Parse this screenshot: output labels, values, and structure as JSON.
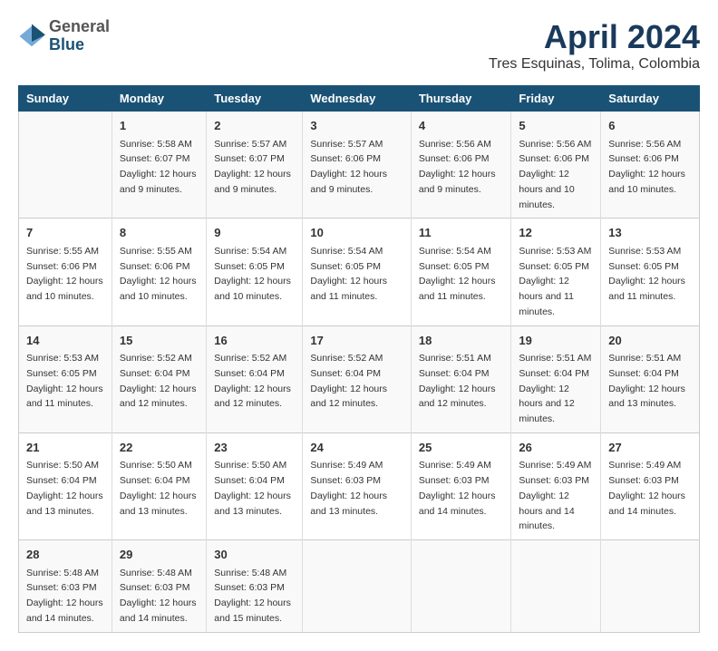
{
  "logo": {
    "general": "General",
    "blue": "Blue"
  },
  "title": "April 2024",
  "subtitle": "Tres Esquinas, Tolima, Colombia",
  "columns": [
    "Sunday",
    "Monday",
    "Tuesday",
    "Wednesday",
    "Thursday",
    "Friday",
    "Saturday"
  ],
  "weeks": [
    [
      {
        "day": "",
        "sunrise": "",
        "sunset": "",
        "daylight": ""
      },
      {
        "day": "1",
        "sunrise": "Sunrise: 5:58 AM",
        "sunset": "Sunset: 6:07 PM",
        "daylight": "Daylight: 12 hours and 9 minutes."
      },
      {
        "day": "2",
        "sunrise": "Sunrise: 5:57 AM",
        "sunset": "Sunset: 6:07 PM",
        "daylight": "Daylight: 12 hours and 9 minutes."
      },
      {
        "day": "3",
        "sunrise": "Sunrise: 5:57 AM",
        "sunset": "Sunset: 6:06 PM",
        "daylight": "Daylight: 12 hours and 9 minutes."
      },
      {
        "day": "4",
        "sunrise": "Sunrise: 5:56 AM",
        "sunset": "Sunset: 6:06 PM",
        "daylight": "Daylight: 12 hours and 9 minutes."
      },
      {
        "day": "5",
        "sunrise": "Sunrise: 5:56 AM",
        "sunset": "Sunset: 6:06 PM",
        "daylight": "Daylight: 12 hours and 10 minutes."
      },
      {
        "day": "6",
        "sunrise": "Sunrise: 5:56 AM",
        "sunset": "Sunset: 6:06 PM",
        "daylight": "Daylight: 12 hours and 10 minutes."
      }
    ],
    [
      {
        "day": "7",
        "sunrise": "Sunrise: 5:55 AM",
        "sunset": "Sunset: 6:06 PM",
        "daylight": "Daylight: 12 hours and 10 minutes."
      },
      {
        "day": "8",
        "sunrise": "Sunrise: 5:55 AM",
        "sunset": "Sunset: 6:06 PM",
        "daylight": "Daylight: 12 hours and 10 minutes."
      },
      {
        "day": "9",
        "sunrise": "Sunrise: 5:54 AM",
        "sunset": "Sunset: 6:05 PM",
        "daylight": "Daylight: 12 hours and 10 minutes."
      },
      {
        "day": "10",
        "sunrise": "Sunrise: 5:54 AM",
        "sunset": "Sunset: 6:05 PM",
        "daylight": "Daylight: 12 hours and 11 minutes."
      },
      {
        "day": "11",
        "sunrise": "Sunrise: 5:54 AM",
        "sunset": "Sunset: 6:05 PM",
        "daylight": "Daylight: 12 hours and 11 minutes."
      },
      {
        "day": "12",
        "sunrise": "Sunrise: 5:53 AM",
        "sunset": "Sunset: 6:05 PM",
        "daylight": "Daylight: 12 hours and 11 minutes."
      },
      {
        "day": "13",
        "sunrise": "Sunrise: 5:53 AM",
        "sunset": "Sunset: 6:05 PM",
        "daylight": "Daylight: 12 hours and 11 minutes."
      }
    ],
    [
      {
        "day": "14",
        "sunrise": "Sunrise: 5:53 AM",
        "sunset": "Sunset: 6:05 PM",
        "daylight": "Daylight: 12 hours and 11 minutes."
      },
      {
        "day": "15",
        "sunrise": "Sunrise: 5:52 AM",
        "sunset": "Sunset: 6:04 PM",
        "daylight": "Daylight: 12 hours and 12 minutes."
      },
      {
        "day": "16",
        "sunrise": "Sunrise: 5:52 AM",
        "sunset": "Sunset: 6:04 PM",
        "daylight": "Daylight: 12 hours and 12 minutes."
      },
      {
        "day": "17",
        "sunrise": "Sunrise: 5:52 AM",
        "sunset": "Sunset: 6:04 PM",
        "daylight": "Daylight: 12 hours and 12 minutes."
      },
      {
        "day": "18",
        "sunrise": "Sunrise: 5:51 AM",
        "sunset": "Sunset: 6:04 PM",
        "daylight": "Daylight: 12 hours and 12 minutes."
      },
      {
        "day": "19",
        "sunrise": "Sunrise: 5:51 AM",
        "sunset": "Sunset: 6:04 PM",
        "daylight": "Daylight: 12 hours and 12 minutes."
      },
      {
        "day": "20",
        "sunrise": "Sunrise: 5:51 AM",
        "sunset": "Sunset: 6:04 PM",
        "daylight": "Daylight: 12 hours and 13 minutes."
      }
    ],
    [
      {
        "day": "21",
        "sunrise": "Sunrise: 5:50 AM",
        "sunset": "Sunset: 6:04 PM",
        "daylight": "Daylight: 12 hours and 13 minutes."
      },
      {
        "day": "22",
        "sunrise": "Sunrise: 5:50 AM",
        "sunset": "Sunset: 6:04 PM",
        "daylight": "Daylight: 12 hours and 13 minutes."
      },
      {
        "day": "23",
        "sunrise": "Sunrise: 5:50 AM",
        "sunset": "Sunset: 6:04 PM",
        "daylight": "Daylight: 12 hours and 13 minutes."
      },
      {
        "day": "24",
        "sunrise": "Sunrise: 5:49 AM",
        "sunset": "Sunset: 6:03 PM",
        "daylight": "Daylight: 12 hours and 13 minutes."
      },
      {
        "day": "25",
        "sunrise": "Sunrise: 5:49 AM",
        "sunset": "Sunset: 6:03 PM",
        "daylight": "Daylight: 12 hours and 14 minutes."
      },
      {
        "day": "26",
        "sunrise": "Sunrise: 5:49 AM",
        "sunset": "Sunset: 6:03 PM",
        "daylight": "Daylight: 12 hours and 14 minutes."
      },
      {
        "day": "27",
        "sunrise": "Sunrise: 5:49 AM",
        "sunset": "Sunset: 6:03 PM",
        "daylight": "Daylight: 12 hours and 14 minutes."
      }
    ],
    [
      {
        "day": "28",
        "sunrise": "Sunrise: 5:48 AM",
        "sunset": "Sunset: 6:03 PM",
        "daylight": "Daylight: 12 hours and 14 minutes."
      },
      {
        "day": "29",
        "sunrise": "Sunrise: 5:48 AM",
        "sunset": "Sunset: 6:03 PM",
        "daylight": "Daylight: 12 hours and 14 minutes."
      },
      {
        "day": "30",
        "sunrise": "Sunrise: 5:48 AM",
        "sunset": "Sunset: 6:03 PM",
        "daylight": "Daylight: 12 hours and 15 minutes."
      },
      {
        "day": "",
        "sunrise": "",
        "sunset": "",
        "daylight": ""
      },
      {
        "day": "",
        "sunrise": "",
        "sunset": "",
        "daylight": ""
      },
      {
        "day": "",
        "sunrise": "",
        "sunset": "",
        "daylight": ""
      },
      {
        "day": "",
        "sunrise": "",
        "sunset": "",
        "daylight": ""
      }
    ]
  ]
}
